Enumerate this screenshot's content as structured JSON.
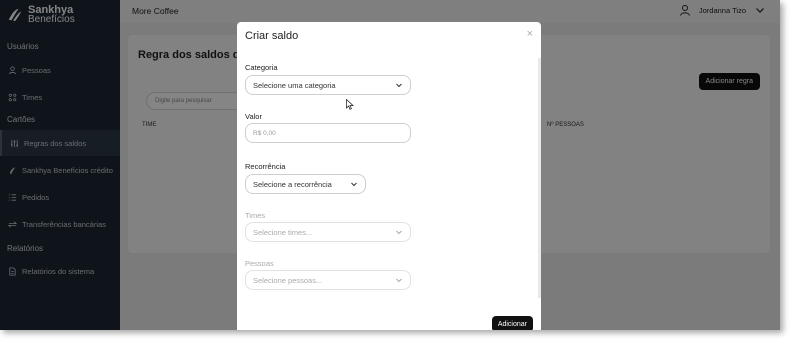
{
  "brand": {
    "line1": "Sankhya",
    "line2": "Benefícios"
  },
  "sidebar": {
    "sections": [
      {
        "title": "Usuários"
      },
      {
        "title": "Cartões"
      },
      {
        "title": "Relatórios"
      }
    ],
    "items": [
      {
        "label": "Pessoas",
        "icon": "people-icon"
      },
      {
        "label": "Times",
        "icon": "team-icon"
      },
      {
        "label": "Regras dos saldos",
        "icon": "rules-icon",
        "active": true
      },
      {
        "label": "Sankhya Benefícios crédito",
        "icon": "card-icon"
      },
      {
        "label": "Pedidos",
        "icon": "list-icon"
      },
      {
        "label": "Transferências bancárias",
        "icon": "transfer-icon"
      },
      {
        "label": "Relatórios do sistema",
        "icon": "report-icon"
      }
    ]
  },
  "topbar": {
    "company": "More Coffee",
    "user_name": "Jordanna Tizo"
  },
  "page": {
    "title": "Regra dos saldos da",
    "search_placeholder": "Digite para pesquisar",
    "add_rule_label": "Adicionar regra",
    "columns": [
      "TIME",
      "Nº PESSOAS"
    ]
  },
  "modal": {
    "title": "Criar saldo",
    "close": "×",
    "categoria_label": "Categoria",
    "categoria_value": "Selecione uma categoria",
    "valor_label": "Valor",
    "valor_placeholder": "R$ 0,00",
    "recorrencia_label": "Recorrência",
    "recorrencia_value": "Selecione a recorrência",
    "times_label": "Times",
    "times_value": "Selecione times...",
    "pessoas_label": "Pessoas",
    "pessoas_value": "Selecione pessoas...",
    "submit_label": "Adicionar"
  },
  "colors": {
    "sidebar_bg": "#1d2733",
    "primary_button": "#111111",
    "overlay": "rgba(0,0,0,0.48)"
  }
}
